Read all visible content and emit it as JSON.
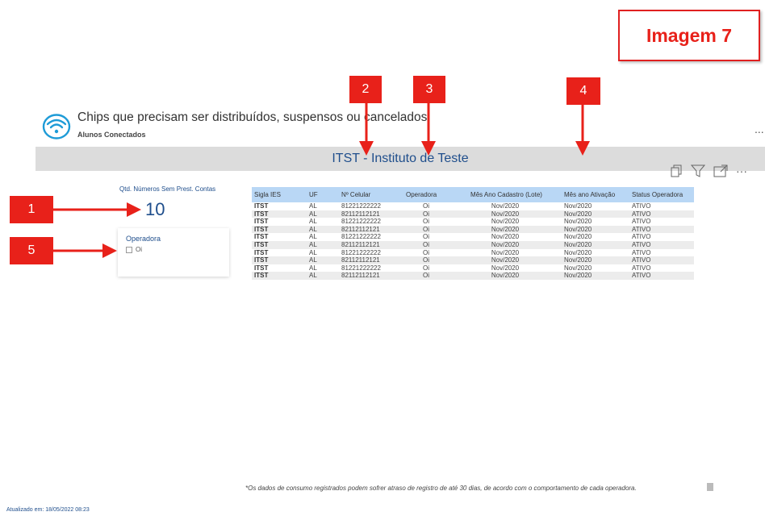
{
  "badge": {
    "label": "Imagem 7"
  },
  "header": {
    "title": "Chips que precisam ser distribuídos, suspensos ou cancelados",
    "subtitle": "Alunos Conectados",
    "more": "..."
  },
  "banner": {
    "title": "ITST - Instituto de Teste"
  },
  "visual_tools": {
    "more": "···"
  },
  "kpi": {
    "label": "Qtd. Números Sem Prest. Contas",
    "value": "10"
  },
  "slicer": {
    "title": "Operadora",
    "option": "Oi",
    "checked": false
  },
  "table": {
    "columns": [
      "Sigla IES",
      "UF",
      "Nº Celular",
      "Operadora",
      "Mês Ano Cadastro (Lote)",
      "Mês ano Ativação",
      "Status Operadora"
    ],
    "rows": [
      [
        "ITST",
        "AL",
        "81221222222",
        "Oi",
        "Nov/2020",
        "Nov/2020",
        "ATIVO"
      ],
      [
        "ITST",
        "AL",
        "82112112121",
        "Oi",
        "Nov/2020",
        "Nov/2020",
        "ATIVO"
      ],
      [
        "ITST",
        "AL",
        "81221222222",
        "Oi",
        "Nov/2020",
        "Nov/2020",
        "ATIVO"
      ],
      [
        "ITST",
        "AL",
        "82112112121",
        "Oi",
        "Nov/2020",
        "Nov/2020",
        "ATIVO"
      ],
      [
        "ITST",
        "AL",
        "81221222222",
        "Oi",
        "Nov/2020",
        "Nov/2020",
        "ATIVO"
      ],
      [
        "ITST",
        "AL",
        "82112112121",
        "Oi",
        "Nov/2020",
        "Nov/2020",
        "ATIVO"
      ],
      [
        "ITST",
        "AL",
        "81221222222",
        "Oi",
        "Nov/2020",
        "Nov/2020",
        "ATIVO"
      ],
      [
        "ITST",
        "AL",
        "82112112121",
        "Oi",
        "Nov/2020",
        "Nov/2020",
        "ATIVO"
      ],
      [
        "ITST",
        "AL",
        "81221222222",
        "Oi",
        "Nov/2020",
        "Nov/2020",
        "ATIVO"
      ],
      [
        "ITST",
        "AL",
        "82112112121",
        "Oi",
        "Nov/2020",
        "Nov/2020",
        "ATIVO"
      ]
    ]
  },
  "markers": [
    "1",
    "2",
    "3",
    "4",
    "5"
  ],
  "footnote": "*Os dados de consumo registrados podem sofrer atraso de registro de até 30 dias, de acordo com o comportamento de cada operadora.",
  "updated": "Atualizado em: 18/05/2022 08:23",
  "colors": {
    "accent": "#e8211a",
    "brand_blue": "#1f4e8c",
    "header_blue": "#b9d7f5",
    "banner_gray": "#dcdcdc"
  },
  "icons": [
    "wifi-icon",
    "copy-icon",
    "filter-icon",
    "focus-mode-icon",
    "more-options-icon"
  ]
}
